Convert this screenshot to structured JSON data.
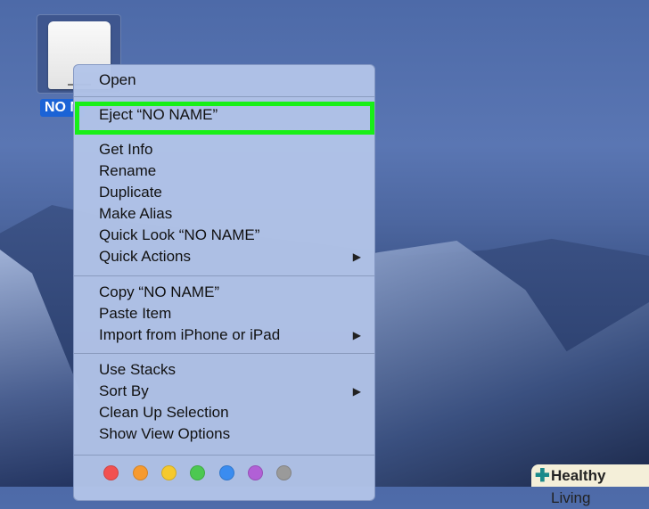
{
  "desktop": {
    "drive_label": "NO NAME",
    "drive_label_visible": "NO N"
  },
  "menu": {
    "items": [
      {
        "label": "Open"
      },
      {
        "label": "Eject “NO NAME”",
        "highlighted": true
      },
      {
        "label": "Get Info"
      },
      {
        "label": "Rename"
      },
      {
        "label": "Duplicate"
      },
      {
        "label": "Make Alias"
      },
      {
        "label": "Quick Look “NO NAME”"
      },
      {
        "label": "Quick Actions",
        "submenu": true
      },
      {
        "label": "Copy “NO NAME”"
      },
      {
        "label": "Paste Item"
      },
      {
        "label": "Import from iPhone or iPad",
        "submenu": true
      },
      {
        "label": "Use Stacks"
      },
      {
        "label": "Sort By",
        "submenu": true
      },
      {
        "label": "Clean Up Selection"
      },
      {
        "label": "Show View Options"
      }
    ],
    "submenu_arrow": "▶",
    "tags": [
      "#f25050",
      "#f79a2e",
      "#f5c92e",
      "#4cc851",
      "#3a8cf0",
      "#b160d6",
      "#9a9a9a"
    ],
    "highlight_color": "#18ef18"
  },
  "watermark": {
    "bold": "Healthy",
    "rest": " Living",
    "icon": "plus-icon"
  }
}
